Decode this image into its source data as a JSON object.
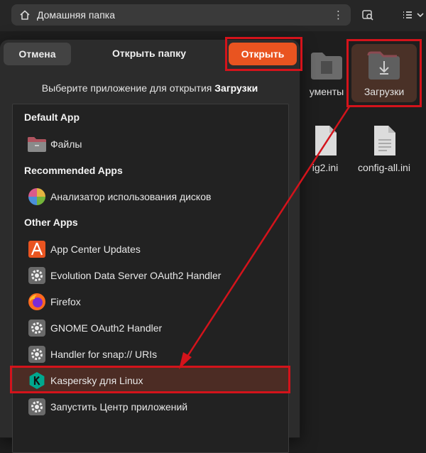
{
  "file_manager": {
    "path_title": "Домашняя папка",
    "files": [
      {
        "name": "ументы"
      },
      {
        "name": "Загрузки"
      },
      {
        "name": "ig2.ini"
      },
      {
        "name": "config-all.ini"
      }
    ]
  },
  "dialog": {
    "cancel_label": "Отмена",
    "title": "Открыть папку",
    "open_label": "Открыть",
    "subtitle_prefix": "Выберите приложение для открытия ",
    "subtitle_target": "Загрузки",
    "sections": {
      "default": "Default App",
      "recommended": "Recommended Apps",
      "other": "Other Apps"
    },
    "apps": {
      "files": "Файлы",
      "disk_analyzer": "Анализатор использования дисков",
      "app_center_updates": "App Center Updates",
      "evolution": "Evolution Data Server OAuth2 Handler",
      "firefox": "Firefox",
      "gnome_oauth": "GNOME OAuth2 Handler",
      "snap_handler": "Handler for snap:// URIs",
      "kaspersky": "Kaspersky для Linux",
      "launch_app_center": "Запустить Центр приложений"
    }
  },
  "colors": {
    "accent": "#e95420",
    "annotation": "#d4131b",
    "kaspersky": "#00a88e"
  }
}
